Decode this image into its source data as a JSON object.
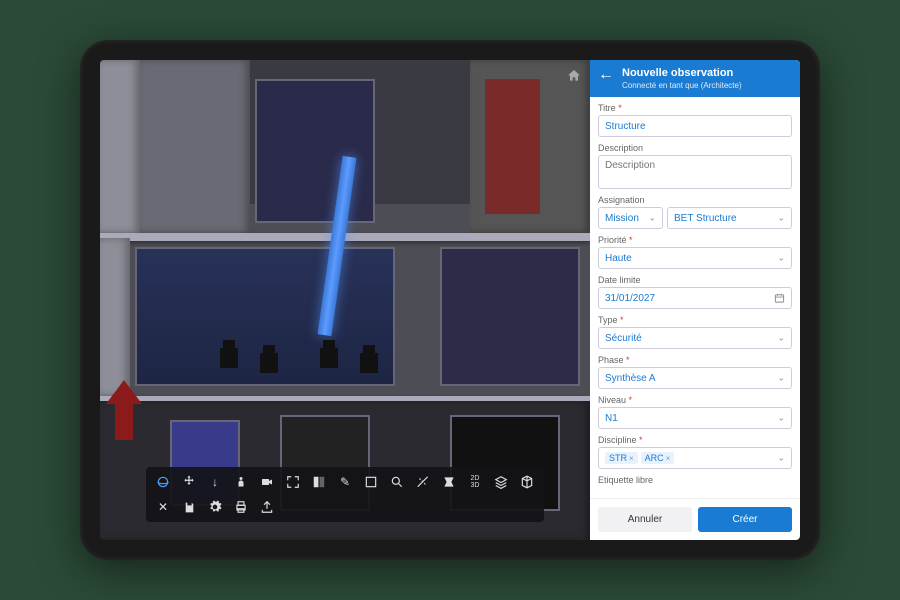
{
  "header": {
    "title": "Nouvelle observation",
    "subtitle": "Connecté en tant que (Architecte)"
  },
  "fields": {
    "title_label": "Titre",
    "title_value": "Structure",
    "description_label": "Description",
    "description_placeholder": "Description",
    "assignation_label": "Assignation",
    "assignation_scope": "Mission",
    "assignation_value": "BET Structure",
    "priority_label": "Priorité",
    "priority_value": "Haute",
    "deadline_label": "Date limite",
    "deadline_value": "31/01/2027",
    "type_label": "Type",
    "type_value": "Sécurité",
    "phase_label": "Phase",
    "phase_value": "Synthèse A",
    "level_label": "Niveau",
    "level_value": "N1",
    "discipline_label": "Discipline",
    "discipline_chips": [
      "STR",
      "ARC"
    ],
    "freetag_label": "Etiquette libre"
  },
  "footer": {
    "cancel": "Annuler",
    "create": "Créer"
  },
  "toolbar": {
    "row1": [
      "orbit",
      "pan",
      "walk",
      "person",
      "camera",
      "fit",
      "compare",
      "pencil",
      "area",
      "search",
      "measure",
      "section",
      "viewcube",
      "layers",
      "cube"
    ],
    "row2": [
      "x",
      "save",
      "gear",
      "print",
      "export"
    ]
  }
}
